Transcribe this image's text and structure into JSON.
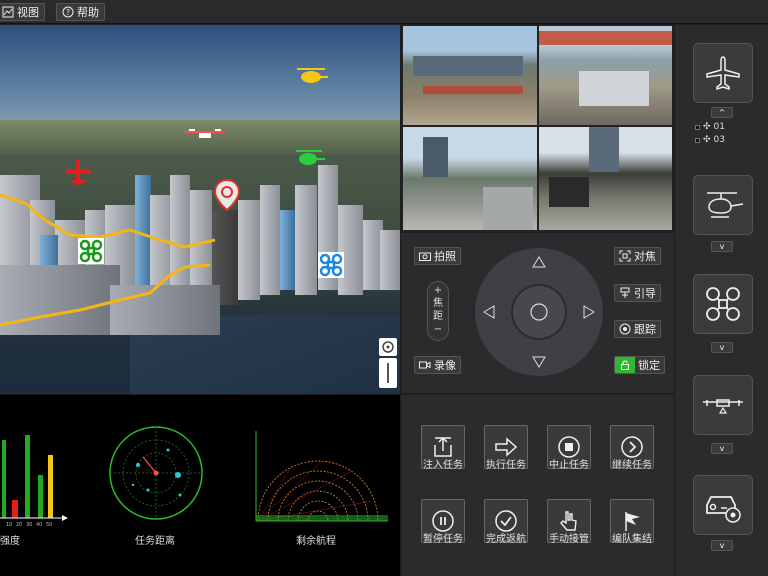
{
  "topbar": {
    "view_label": "视图",
    "help_label": "帮助"
  },
  "charts": {
    "signal_label": "强度",
    "distance_label": "任务距离",
    "range_label": "剩余航程",
    "bar_ticks": [
      "10",
      "20",
      "30",
      "40",
      "50"
    ]
  },
  "ptz": {
    "photo_label": "拍照",
    "record_label": "录像",
    "focus_plus": "+",
    "focus_label_1": "焦",
    "focus_label_2": "距",
    "focus_minus": "−",
    "focus_btn_label": "对焦",
    "guide_label": "引导",
    "track_label": "跟踪",
    "lock_label": "锁定"
  },
  "mission": {
    "buttons": [
      {
        "label": "注入任务",
        "icon": "upload-icon"
      },
      {
        "label": "执行任务",
        "icon": "arrow-right-icon"
      },
      {
        "label": "中止任务",
        "icon": "stop-icon"
      },
      {
        "label": "继续任务",
        "icon": "play-icon"
      },
      {
        "label": "暂停任务",
        "icon": "pause-icon"
      },
      {
        "label": "完成返航",
        "icon": "check-icon"
      },
      {
        "label": "手动接管",
        "icon": "hand-icon"
      },
      {
        "label": "编队集结",
        "icon": "flag-icon"
      }
    ]
  },
  "rightbar": {
    "drone_list": [
      {
        "label": "01"
      },
      {
        "label": "03"
      }
    ],
    "up_chevron": "^",
    "down_chevron": "v"
  },
  "colors": {
    "accent_green": "#2db82d",
    "path_yellow": "#f5b614",
    "panel_bg": "#2b2b2e"
  }
}
